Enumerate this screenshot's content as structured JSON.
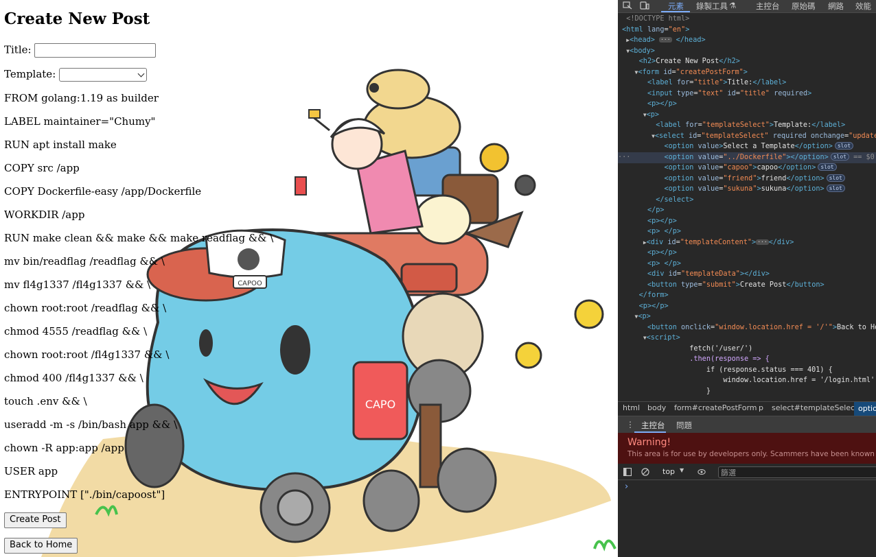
{
  "page": {
    "heading": "Create New Post",
    "title_label": "Title:",
    "template_label": "Template:",
    "template_lines": [
      "FROM golang:1.19 as builder",
      "LABEL maintainer=\"Chumy\"",
      "RUN apt install make",
      "COPY src /app",
      "COPY Dockerfile-easy /app/Dockerfile",
      "WORKDIR /app",
      "RUN make clean && make && make readflag && \\",
      "mv bin/readflag /readflag && \\",
      "mv fl4g1337 /fl4g1337 && \\",
      "chown root:root /readflag && \\",
      "chmod 4555 /readflag && \\",
      "chown root:root /fl4g1337 && \\",
      "chmod 400 /fl4g1337 && \\",
      "touch .env && \\",
      "useradd -m -s /bin/bash app && \\",
      "chown -R app:app /app",
      "USER app",
      "ENTRYPOINT [\"./bin/capoost\"]"
    ],
    "create_button": "Create Post",
    "back_button": "Back to Home",
    "mascot_can_text": "CAPO",
    "mascot_hat_text": "CAPOO"
  },
  "devtools": {
    "tabs": [
      "元素",
      "錄製工具 ",
      "主控台",
      "原始碼",
      "網路",
      "效能"
    ],
    "active_tab": "元素",
    "dom": {
      "doctype": "<!DOCTYPE html>",
      "html_open": "<html lang=\"en\">",
      "lang": "en",
      "head": "<head>",
      "head_close": "</head>",
      "body": "<body>",
      "h2_text": "Create New Post",
      "form_id": "createPostForm",
      "title_label_text": "Title:",
      "input_type": "text",
      "input_id": "title",
      "template_label_text": "Template:",
      "select_id": "templateSelect",
      "options": [
        {
          "value": "",
          "text": "Select a Template"
        },
        {
          "value": "../Dockerfile",
          "text": ""
        },
        {
          "value": "capoo",
          "text": "capoo"
        },
        {
          "value": "friend",
          "text": "friend"
        },
        {
          "value": "sukuna",
          "text": "sukuna"
        }
      ],
      "slot_badge": "slot",
      "selected_marker": "== $0",
      "template_content_id": "templateContent",
      "template_data_id": "templateData",
      "submit_text": "Create Post",
      "back_onclick": "window.location.href = '/'",
      "back_text": "Back to Hom",
      "script_lines": [
        "fetch('/user/')",
        ".then(response => {",
        "if (response.status === 401) {",
        "window.location.href = '/login.html';",
        "}"
      ]
    },
    "breadcrumbs": [
      "html",
      "body",
      "form#createPostForm",
      "p",
      "select#templateSelect",
      "optio"
    ],
    "drawer_tabs": [
      "主控台",
      "問題"
    ],
    "warning_title": "Warning!",
    "warning_text": "This area is for use by developers only. Scammers have been known to e",
    "context": "top",
    "filter_placeholder": "篩選",
    "prompt": "›"
  },
  "colors": {
    "devtools_bg": "#282828",
    "accent": "#7cacf8",
    "tag": "#5db0d7",
    "attr_value": "#f28b54",
    "warning_bg": "#4e1111",
    "mascot_blue": "#74cce6"
  }
}
